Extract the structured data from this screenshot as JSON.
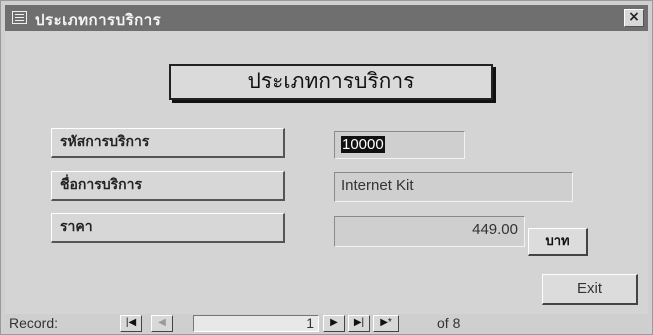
{
  "window": {
    "title": "ประเภทการบริการ",
    "close_label": "×"
  },
  "form": {
    "heading": "ประเภทการบริการ",
    "fields": [
      {
        "label": "รหัสการบริการ",
        "value": "10000"
      },
      {
        "label": "ชื่อการบริการ",
        "value": "Internet Kit"
      },
      {
        "label": "ราคา",
        "value": "449.00"
      }
    ],
    "unit_label": "บาท",
    "exit_label": "Exit"
  },
  "record_nav": {
    "label": "Record:",
    "first": "|◀",
    "prev": "◀",
    "current": "1",
    "next": "▶",
    "last": "▶|",
    "new": "▶*",
    "of_text": "of 8"
  }
}
